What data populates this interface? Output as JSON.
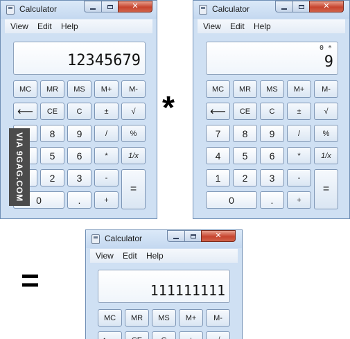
{
  "window_title": "Calculator",
  "menu": [
    "View",
    "Edit",
    "Help"
  ],
  "buttons": {
    "mc": "MC",
    "mr": "MR",
    "ms": "MS",
    "mplus": "M+",
    "mminus": "M-",
    "backspace": "⟵",
    "ce": "CE",
    "c": "C",
    "plusminus": "±",
    "sqrt": "√",
    "seven": "7",
    "eight": "8",
    "nine": "9",
    "divide": "/",
    "percent": "%",
    "four": "4",
    "five": "5",
    "six": "6",
    "multiply": "*",
    "reciprocal": "1/x",
    "one": "1",
    "two": "2",
    "three": "3",
    "minus": "-",
    "equals": "=",
    "zero": "0",
    "decimal": ".",
    "plus": "+"
  },
  "calculators": [
    {
      "display": "12345679",
      "memory_line": ""
    },
    {
      "display": "9",
      "memory_line": "0 *"
    },
    {
      "display": "111111111",
      "memory_line": ""
    }
  ],
  "operators": {
    "times": "*",
    "equals": "="
  },
  "watermark": "VIA 9GAG.COM",
  "colors": {
    "window_frame": "#cfe0f3",
    "close_button": "#c7452f",
    "display_bg": "#ffffff"
  }
}
